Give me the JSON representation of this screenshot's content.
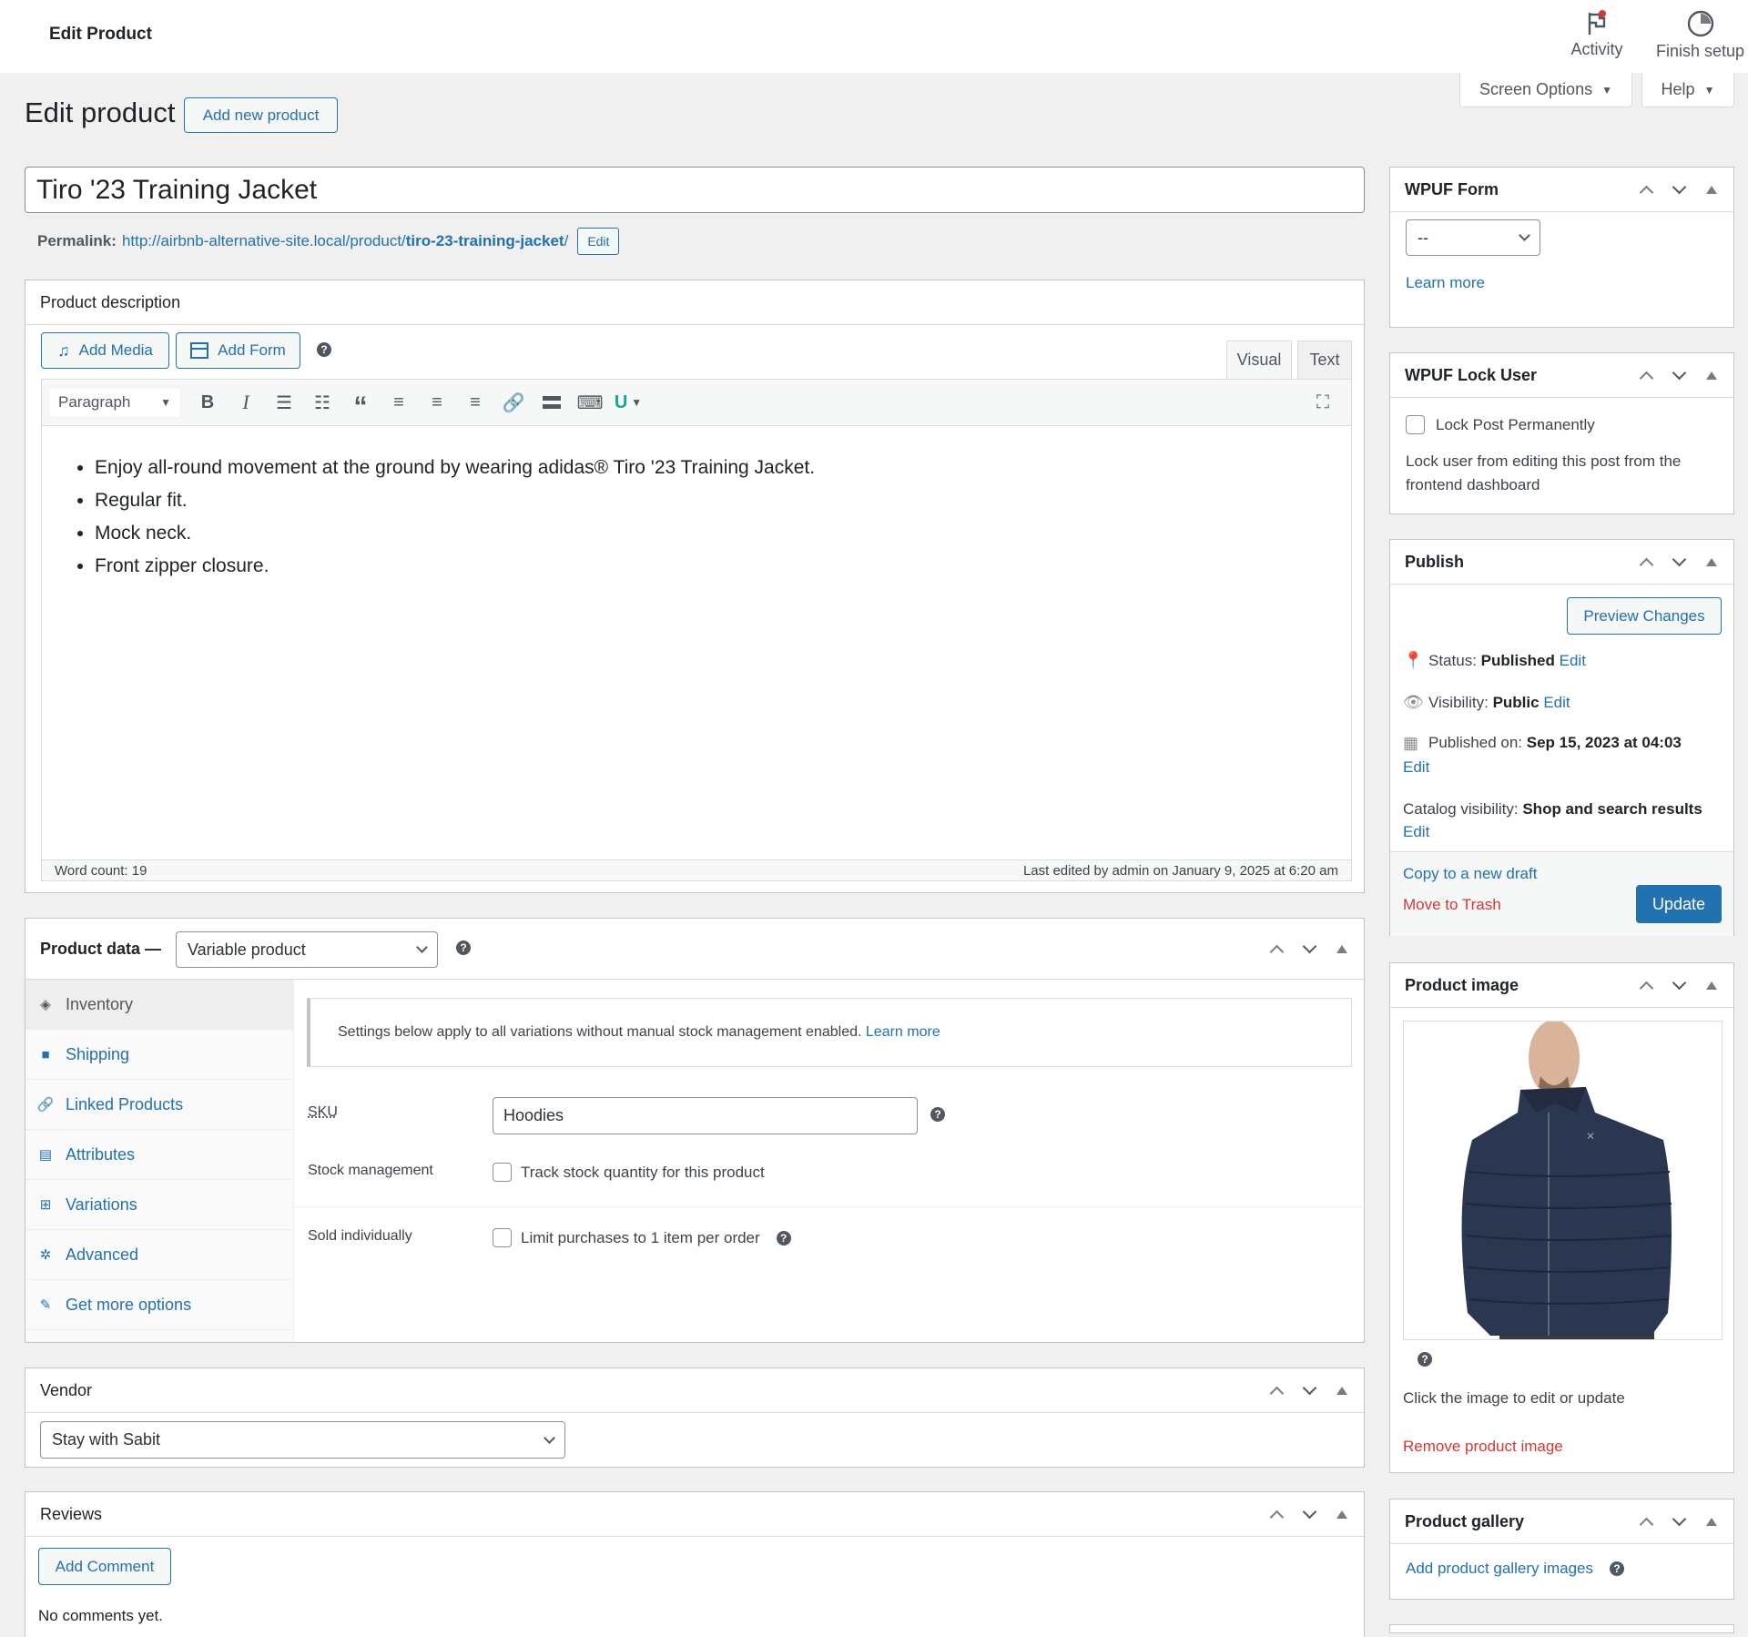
{
  "topbar": {
    "title": "Edit Product",
    "activity_label": "Activity",
    "finish_setup_label": "Finish setup"
  },
  "screen_options_label": "Screen Options",
  "help_label": "Help",
  "page": {
    "heading": "Edit product",
    "add_new_label": "Add new product"
  },
  "post": {
    "title": "Tiro '23 Training Jacket",
    "permalink_label": "Permalink:",
    "permalink_base": "http://airbnb-alternative-site.local/product/",
    "permalink_slug": "tiro-23-training-jacket",
    "permalink_trailing": "/",
    "permalink_edit_label": "Edit"
  },
  "description": {
    "box_title": "Product description",
    "add_media_label": "Add Media",
    "add_form_label": "Add Form",
    "tab_visual": "Visual",
    "tab_text": "Text",
    "format_select": "Paragraph",
    "bullets": [
      "Enjoy all-round movement at the ground by wearing adidas® Tiro '23 Training Jacket.",
      "Regular fit.",
      "Mock neck.",
      "Front zipper closure."
    ],
    "word_count": "Word count: 19",
    "last_edited": "Last edited by admin on January 9, 2025 at 6:20 am"
  },
  "product_data": {
    "label": "Product data —",
    "type_select": "Variable product",
    "tabs": [
      {
        "label": "Inventory",
        "icon": "tag-icon",
        "active": true
      },
      {
        "label": "Shipping",
        "icon": "truck-icon",
        "active": false
      },
      {
        "label": "Linked Products",
        "icon": "link-icon",
        "active": false
      },
      {
        "label": "Attributes",
        "icon": "list-icon",
        "active": false
      },
      {
        "label": "Variations",
        "icon": "grid-icon",
        "active": false
      },
      {
        "label": "Advanced",
        "icon": "gear-icon",
        "active": false
      },
      {
        "label": "Get more options",
        "icon": "plugin-icon",
        "active": false
      }
    ],
    "notice_text": "Settings below apply to all variations without manual stock management enabled.",
    "notice_link": "Learn more",
    "sku_label": "SKU",
    "sku_value": "Hoodies",
    "stock_label": "Stock management",
    "stock_checkbox_label": "Track stock quantity for this product",
    "stock_checked": false,
    "sold_label": "Sold individually",
    "sold_checkbox_label": "Limit purchases to 1 item per order",
    "sold_checked": false
  },
  "vendor": {
    "title": "Vendor",
    "selected": "Stay with Sabit"
  },
  "reviews": {
    "title": "Reviews",
    "add_comment_label": "Add Comment",
    "empty_text": "No comments yet."
  },
  "wpuf_form": {
    "title": "WPUF Form",
    "selected": "--",
    "learn_more": "Learn more"
  },
  "wpuf_lock": {
    "title": "WPUF Lock User",
    "checkbox_label": "Lock Post Permanently",
    "checked": false,
    "description": "Lock user from editing this post from the frontend dashboard"
  },
  "publish": {
    "title": "Publish",
    "preview_label": "Preview Changes",
    "status_label": "Status:",
    "status_value": "Published",
    "visibility_label": "Visibility:",
    "visibility_value": "Public",
    "published_label": "Published on:",
    "published_value": "Sep 15, 2023 at 04:03",
    "catalog_label": "Catalog visibility:",
    "catalog_value": "Shop and search results",
    "edit_label": "Edit",
    "copy_draft": "Copy to a new draft",
    "trash": "Move to Trash",
    "update_label": "Update"
  },
  "product_image": {
    "title": "Product image",
    "hint": "Click the image to edit or update",
    "remove_label": "Remove product image"
  },
  "product_gallery": {
    "title": "Product gallery",
    "add_label": "Add product gallery images"
  },
  "colors": {
    "accent": "#2271b1",
    "danger": "#d63638",
    "background": "#f0f0f1"
  }
}
